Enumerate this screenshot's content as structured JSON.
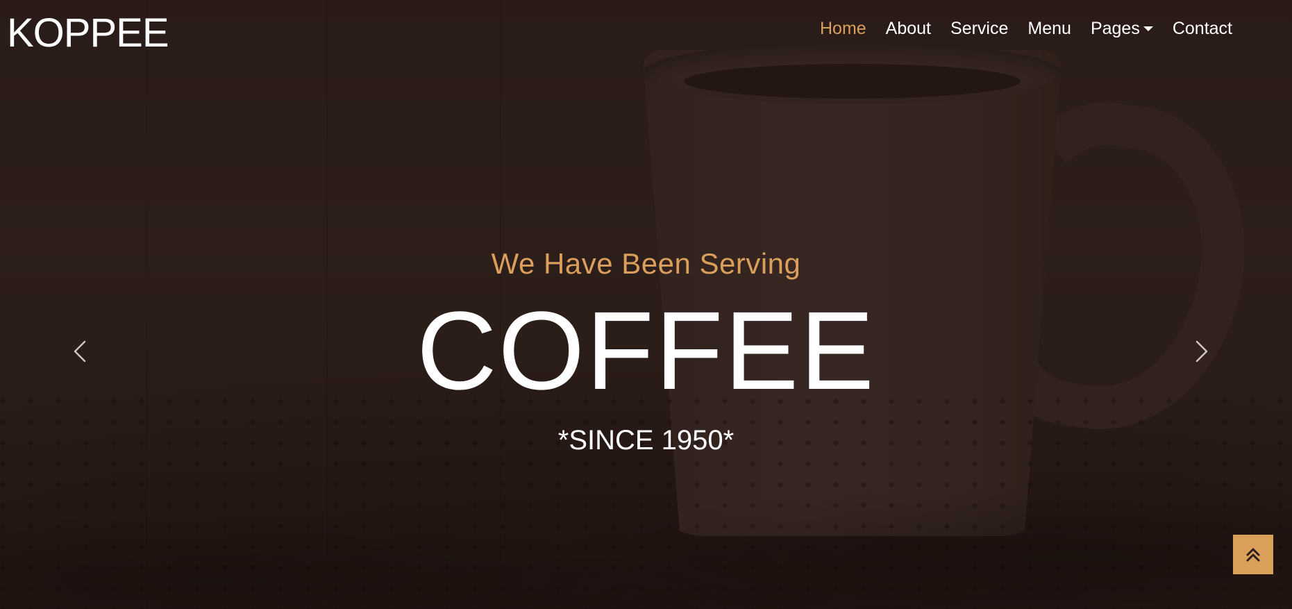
{
  "brand": {
    "logo": "KOPPEE"
  },
  "nav": {
    "items": [
      {
        "label": "Home",
        "active": true
      },
      {
        "label": "About"
      },
      {
        "label": "Service"
      },
      {
        "label": "Menu"
      },
      {
        "label": "Pages",
        "dropdown": true
      },
      {
        "label": "Contact"
      }
    ]
  },
  "hero": {
    "subtitle": "We Have Been Serving",
    "headline": "COFFEE",
    "tagline": "*SINCE 1950*"
  },
  "carousel": {
    "prev_icon": "chevron-left-icon",
    "next_icon": "chevron-right-icon"
  },
  "back_to_top": {
    "icon": "double-chevron-up-icon"
  },
  "colors": {
    "accent": "#da9f5b",
    "background": "#2e201c",
    "text": "#ffffff"
  }
}
